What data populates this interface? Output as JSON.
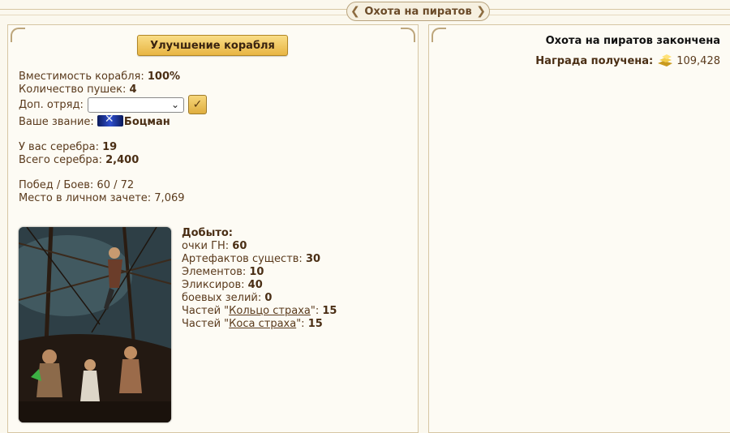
{
  "header": {
    "title": "Охота на пиратов"
  },
  "left": {
    "upgrade_button": "Улучшение корабля",
    "capacity_label": "Вместимость корабля: ",
    "capacity_value": "100%",
    "cannons_label": "Количество пушек: ",
    "cannons_value": "4",
    "squad_label": "Доп. отряд:",
    "squad_selected": "",
    "confirm_icon": "checkmark-icon",
    "rank_label": "Ваше звание: ",
    "rank_value": "Боцман",
    "silver_label": "У вас серебра: ",
    "silver_value": "19",
    "total_silver_label": "Всего серебра: ",
    "total_silver_value": "2,400",
    "wins_line": "Побед / Боев: 60 / 72",
    "place_line": "Место в личном зачете: 7,069",
    "loot": {
      "heading": "Добыто:",
      "items": [
        {
          "label": "очки ГН: ",
          "value": "60"
        },
        {
          "label": "Артефактов существ: ",
          "value": "30"
        },
        {
          "label": "Элементов: ",
          "value": "10"
        },
        {
          "label": "Эликсиров: ",
          "value": "40"
        },
        {
          "label": "боевых зелий: ",
          "value": "0"
        }
      ],
      "parts": [
        {
          "prefix": "Частей \"",
          "link": "Кольцо страха",
          "suffix": "\": ",
          "value": "15"
        },
        {
          "prefix": "Частей \"",
          "link": "Коса страха",
          "suffix": "\": ",
          "value": "15"
        }
      ]
    }
  },
  "right": {
    "finished_title": "Охота на пиратов закончена",
    "reward_label": "Награда получена:",
    "reward_icon": "gold-icon",
    "reward_value": "109,428"
  },
  "colors": {
    "text": "#5a3a1c",
    "button_gold": "#e8b543",
    "background": "#fbf8ee",
    "border": "#d6c6a3"
  }
}
